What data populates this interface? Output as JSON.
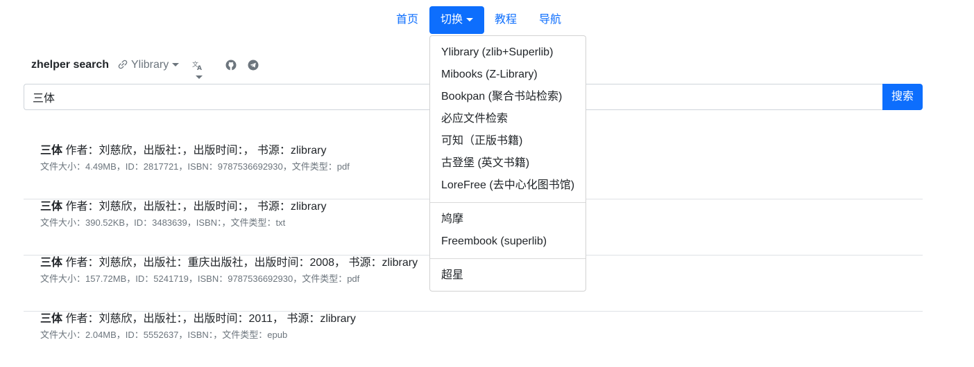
{
  "nav": {
    "items": [
      "首页",
      "切换",
      "教程",
      "导航"
    ]
  },
  "dropdown": {
    "group1": [
      "Ylibrary (zlib+Superlib)",
      "Mibooks (Z-Library)",
      "Bookpan (聚合书站检索)",
      "必应文件检索",
      "可知（正版书籍)",
      "古登堡 (英文书籍)",
      "LoreFree (去中心化图书馆)"
    ],
    "group2": [
      "鸠摩",
      "Freembook (superlib)"
    ],
    "group3": [
      "超星"
    ]
  },
  "appbar": {
    "brand": "zhelper search",
    "source": "Ylibrary",
    "icons": [
      "link-icon",
      "translate-icon",
      "github-icon",
      "telegram-icon"
    ]
  },
  "search": {
    "value": "三体",
    "button": "搜索"
  },
  "results": [
    {
      "title": "三体",
      "author_line": " 作者：刘慈欣，出版社：，出版时间：， 书源：zlibrary",
      "meta": "文件大小：4.49MB，ID：2817721，ISBN：9787536692930，文件类型：pdf"
    },
    {
      "title": "三体",
      "author_line": " 作者：刘慈欣，出版社：，出版时间：， 书源：zlibrary",
      "meta": "文件大小：390.52KB，ID：3483639，ISBN：，文件类型：txt"
    },
    {
      "title": "三体",
      "author_line": " 作者：刘慈欣，出版社：重庆出版社，出版时间：2008， 书源：zlibrary",
      "meta": "文件大小：157.72MB，ID：5241719，ISBN：9787536692930，文件类型：pdf"
    },
    {
      "title": "三体",
      "author_line": " 作者：刘慈欣，出版社：，出版时间：2011， 书源：zlibrary",
      "meta": "文件大小：2.04MB，ID：5552637，ISBN：，文件类型：epub"
    }
  ],
  "colors": {
    "primary": "#0d6efd",
    "muted": "#6c757d",
    "text": "#212529"
  }
}
